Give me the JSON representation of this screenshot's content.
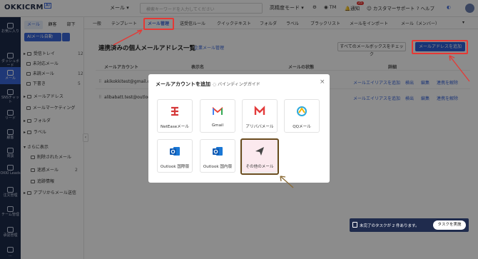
{
  "app": {
    "logo": "OKKICRM",
    "logo_badge": "AI"
  },
  "topbar": {
    "mail_select": "メール",
    "search_placeholder": "検索キーワードを入力してください",
    "search_mode": "高精度モード",
    "tm_label": "TM",
    "notify_label": "通知",
    "notify_count": "25",
    "support_label": "カスタマーサポート",
    "help_label": "ヘルプ"
  },
  "rail": {
    "items": [
      {
        "label": "お気に入り",
        "icon": "star-icon"
      },
      {
        "label": "ダッシュボード",
        "icon": "dashboard-icon"
      },
      {
        "label": "メール",
        "icon": "mail-icon"
      },
      {
        "label": "SNSチャット",
        "icon": "chat-icon"
      },
      {
        "label": "リード",
        "icon": "lead-icon"
      },
      {
        "label": "顧客",
        "icon": "customer-icon"
      },
      {
        "label": "商談",
        "icon": "deal-icon"
      },
      {
        "label": "OKKI Leads",
        "icon": "leads-icon"
      },
      {
        "label": "注文管理",
        "icon": "order-icon"
      },
      {
        "label": "チーム管理",
        "icon": "team-icon"
      },
      {
        "label": "承認管理",
        "icon": "approval-icon"
      },
      {
        "label": "...",
        "icon": "more-icon"
      }
    ]
  },
  "sidebar": {
    "segments": [
      "メール",
      "顧客",
      "部下"
    ],
    "ai_button": "AIメール自動",
    "items": [
      {
        "label": "受信トレイ",
        "count": "12"
      },
      {
        "label": "未対応メール",
        "count": ""
      },
      {
        "label": "未読メール",
        "count": "12"
      },
      {
        "label": "下書き",
        "count": "5"
      },
      {
        "label": "メールアドレス",
        "count": ""
      },
      {
        "label": "メールマーケティング",
        "count": ""
      },
      {
        "label": "フォルダ",
        "count": ""
      },
      {
        "label": "ラベル",
        "count": ""
      },
      {
        "label": "さらに表示",
        "count": ""
      },
      {
        "label": "削除されたメール",
        "count": ""
      },
      {
        "label": "迷惑メール",
        "count": "2"
      },
      {
        "label": "追跡情報",
        "count": ""
      },
      {
        "label": "アプリからメール送信",
        "count": ""
      }
    ]
  },
  "tabs": [
    "一般",
    "テンプレート",
    "メール管理",
    "送受信ルール",
    "クイックテキスト",
    "フォルダ",
    "ラベル",
    "ブラックリスト",
    "メールをインポート",
    "メール（メンバー）"
  ],
  "main": {
    "title": "連携済みの個人メールアドレス一覧",
    "title_link": "企業メール管理",
    "check_all_btn": "すべてのメールボックスをチェック",
    "add_btn": "メールアドレスを追加",
    "columns": [
      "メールアカウント",
      "表示名",
      "メールの状態",
      "詳細"
    ],
    "rows": [
      {
        "account": "akikokkitest@gmail.com"
      },
      {
        "account": "alibabatt.test@outlook.com"
      }
    ],
    "row_actions": [
      "メールエイリアスを追加",
      "検出",
      "編集",
      "連携を解除"
    ]
  },
  "modal": {
    "title": "メールアカウントを追加",
    "guide": "バインディングガイド",
    "providers": [
      {
        "label": "NetEaseメール",
        "icon": "netease-icon"
      },
      {
        "label": "Gmail",
        "icon": "gmail-icon"
      },
      {
        "label": "アリババメール",
        "icon": "alibaba-mail-icon"
      },
      {
        "label": "QQメール",
        "icon": "qq-mail-icon"
      },
      {
        "label": "Outlook 国際版",
        "icon": "outlook-icon"
      },
      {
        "label": "Outlook 国内版",
        "icon": "outlook-cn-icon"
      },
      {
        "label": "その他のメール",
        "icon": "send-icon"
      }
    ]
  },
  "task": {
    "text": "未完了のタスクが 2 件あります。",
    "button": "タスクを実施"
  },
  "colors": {
    "accent": "#3a66d9",
    "rail": "#1d2a4a",
    "highlight": "#e53935",
    "brown": "#6a4b1e"
  }
}
